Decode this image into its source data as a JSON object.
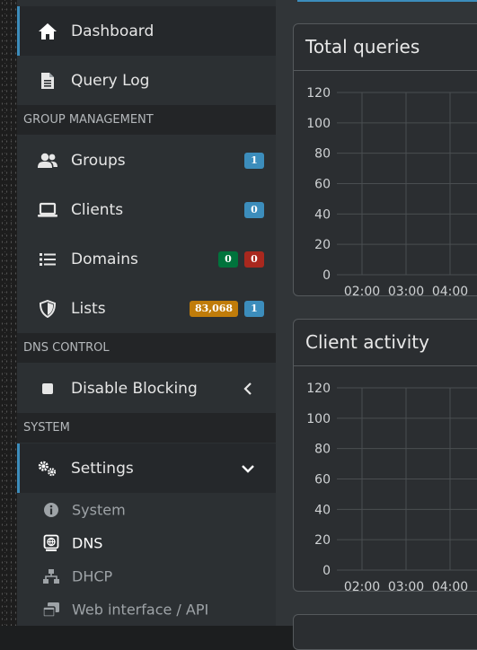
{
  "sidebar": {
    "dashboard": "Dashboard",
    "query_log": "Query Log",
    "group_management_header": "GROUP MANAGEMENT",
    "groups": {
      "label": "Groups",
      "badge": "1"
    },
    "clients": {
      "label": "Clients",
      "badge": "0"
    },
    "domains": {
      "label": "Domains",
      "badge_allow": "0",
      "badge_deny": "0"
    },
    "lists": {
      "label": "Lists",
      "badge_domains": "83,068",
      "badge_lists": "1"
    },
    "dns_control_header": "DNS CONTROL",
    "disable_blocking": "Disable Blocking",
    "system_header": "SYSTEM",
    "settings": "Settings",
    "settings_sub": {
      "system": "System",
      "dns": "DNS",
      "dhcp": "DHCP",
      "web": "Web interface / API"
    }
  },
  "main": {
    "cards": [
      {
        "title": "Total queries"
      },
      {
        "title": "Client activity"
      }
    ]
  },
  "chart_data": [
    {
      "type": "line",
      "title": "Total queries",
      "x": [
        "02:00",
        "03:00",
        "04:00"
      ],
      "yticks": [
        120,
        100,
        80,
        60,
        40,
        20,
        0
      ],
      "ylim": [
        0,
        120
      ],
      "series": [],
      "grid": true
    },
    {
      "type": "line",
      "title": "Client activity",
      "x": [
        "02:00",
        "03:00",
        "04:00"
      ],
      "yticks": [
        120,
        100,
        80,
        60,
        40,
        20,
        0
      ],
      "ylim": [
        0,
        120
      ],
      "series": [],
      "grid": true
    }
  ],
  "colors": {
    "accent": "#3c8dbc",
    "green": "#00733c",
    "red": "#a9281e",
    "orange": "#c07c0a"
  }
}
